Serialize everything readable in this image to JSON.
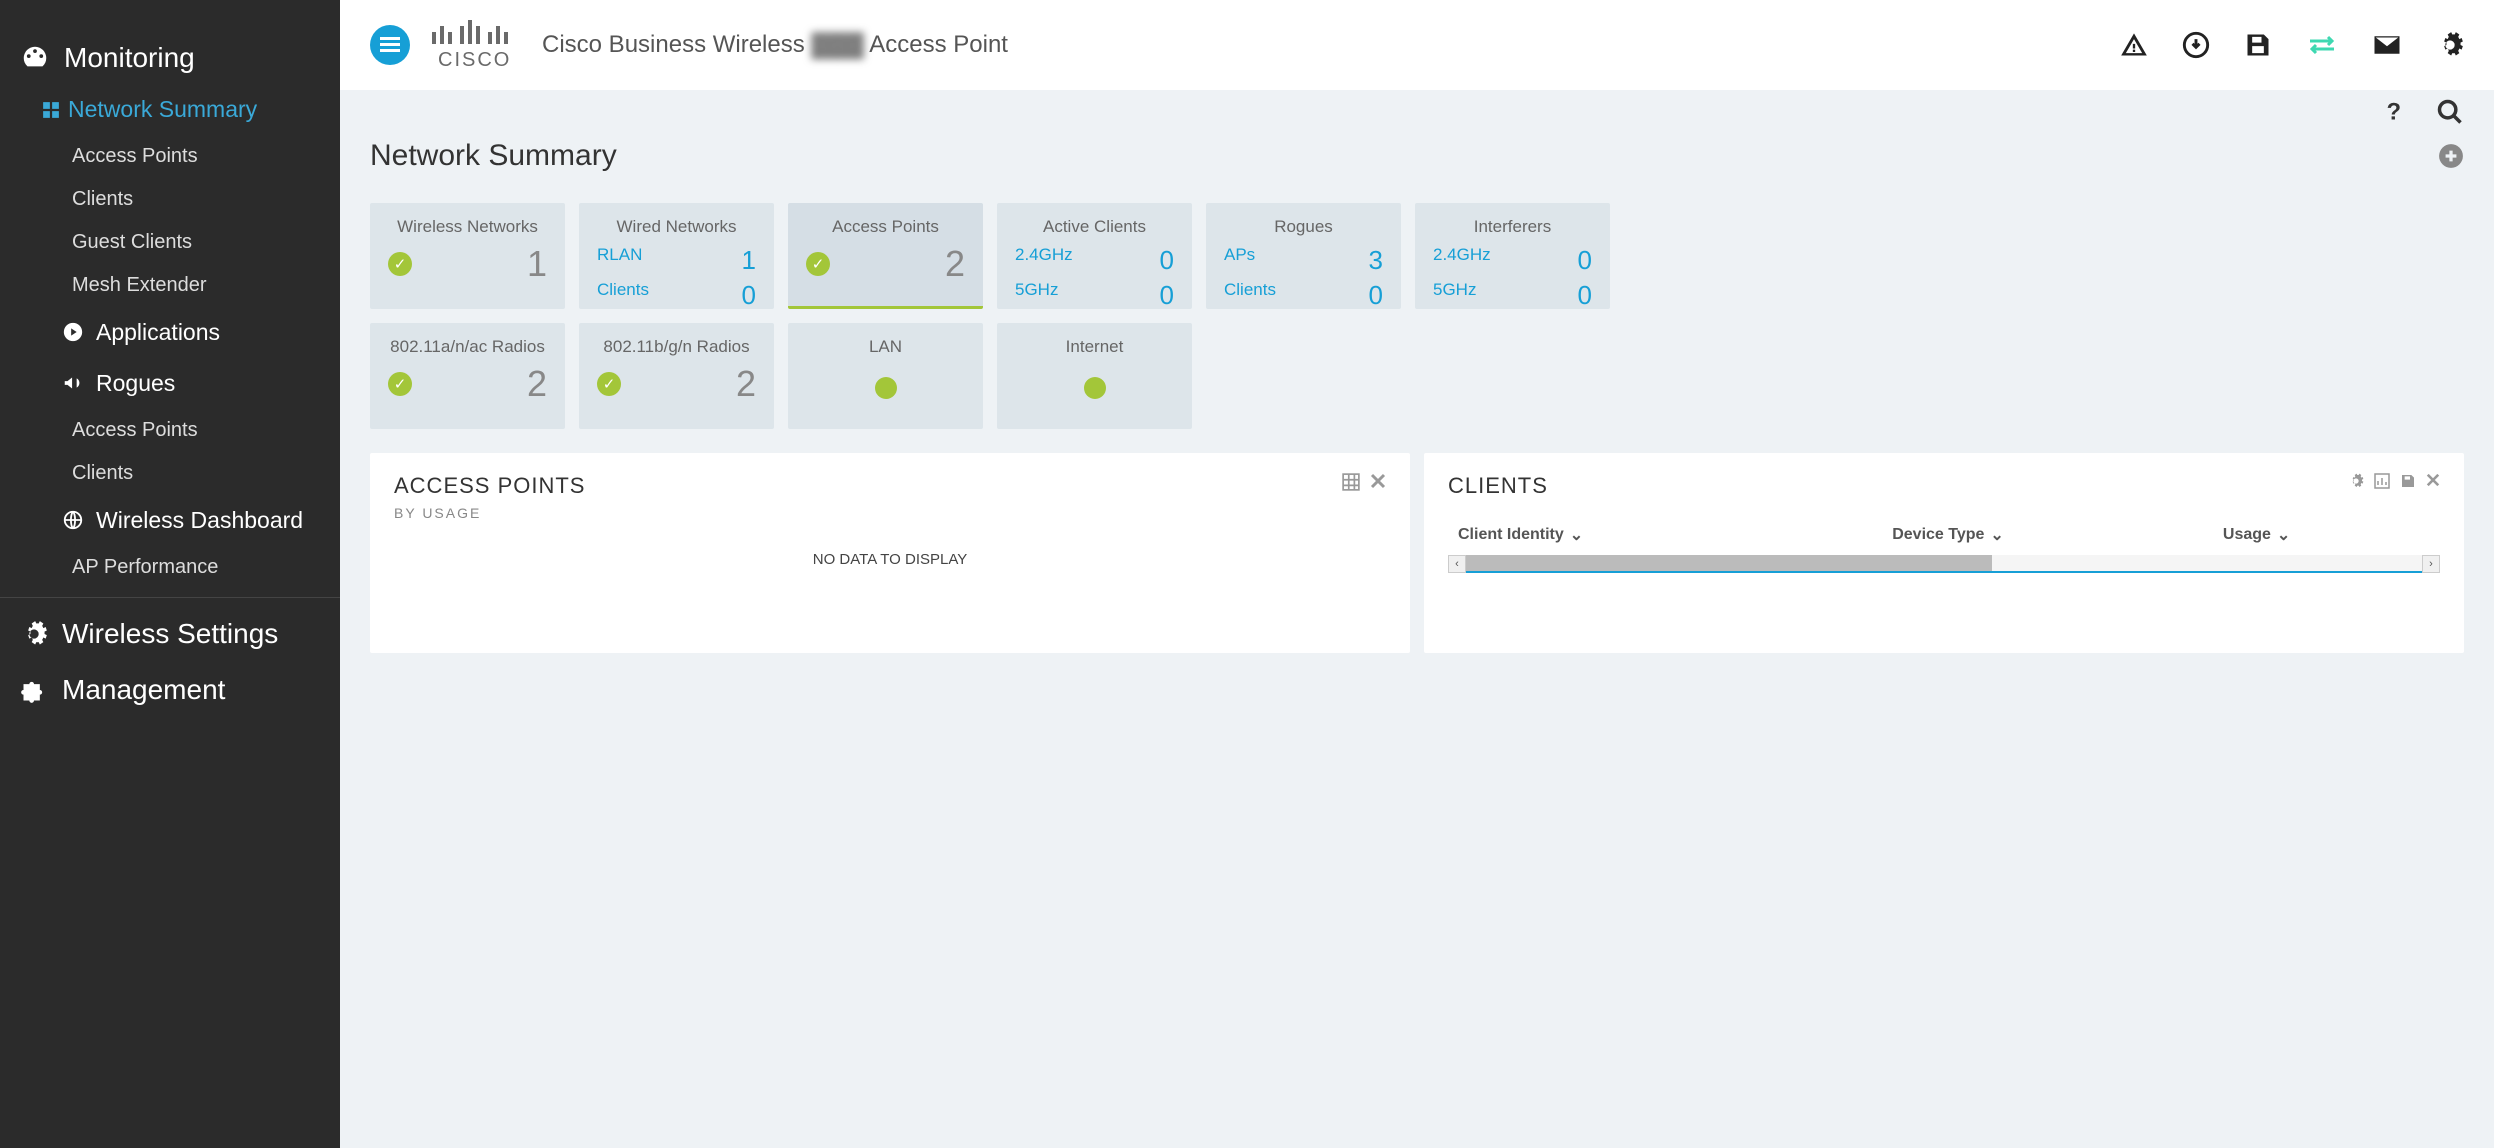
{
  "header": {
    "title_pre": "Cisco Business Wireless",
    "title_blur": "▓▓▓",
    "title_post": "Access Point"
  },
  "sidebar": {
    "monitoring_label": "Monitoring",
    "monitoring_items": [
      "Network Summary",
      "Access Points",
      "Clients",
      "Guest Clients",
      "Mesh Extender"
    ],
    "applications_label": "Applications",
    "rogues_label": "Rogues",
    "rogues_items": [
      "Access Points",
      "Clients"
    ],
    "wireless_dashboard_label": "Wireless Dashboard",
    "wireless_dashboard_items": [
      "AP Performance"
    ],
    "wireless_settings_label": "Wireless Settings",
    "management_label": "Management"
  },
  "page": {
    "title": "Network Summary"
  },
  "tiles_row1": [
    {
      "title": "Wireless Networks",
      "type": "check",
      "value": "1"
    },
    {
      "title": "Wired Networks",
      "type": "kv",
      "rows": [
        {
          "k": "RLAN",
          "v": "1"
        },
        {
          "k": "Clients",
          "v": "0"
        }
      ]
    },
    {
      "title": "Access Points",
      "type": "check",
      "value": "2",
      "active": true
    },
    {
      "title": "Active Clients",
      "type": "kv",
      "rows": [
        {
          "k": "2.4GHz",
          "v": "0"
        },
        {
          "k": "5GHz",
          "v": "0"
        }
      ]
    },
    {
      "title": "Rogues",
      "type": "kv",
      "rows": [
        {
          "k": "APs",
          "v": "3"
        },
        {
          "k": "Clients",
          "v": "0"
        }
      ]
    },
    {
      "title": "Interferers",
      "type": "kv",
      "rows": [
        {
          "k": "2.4GHz",
          "v": "0"
        },
        {
          "k": "5GHz",
          "v": "0"
        }
      ]
    }
  ],
  "tiles_row2": [
    {
      "title": "802.11a/n/ac Radios",
      "type": "check",
      "value": "2"
    },
    {
      "title": "802.11b/g/n Radios",
      "type": "check",
      "value": "2"
    },
    {
      "title": "LAN",
      "type": "dot"
    },
    {
      "title": "Internet",
      "type": "dot"
    }
  ],
  "panels": {
    "ap": {
      "title": "ACCESS POINTS",
      "subtitle": "BY USAGE",
      "no_data": "NO DATA TO DISPLAY"
    },
    "clients": {
      "title": "CLIENTS",
      "columns": [
        "Client Identity",
        "Device Type",
        "Usage"
      ]
    }
  }
}
